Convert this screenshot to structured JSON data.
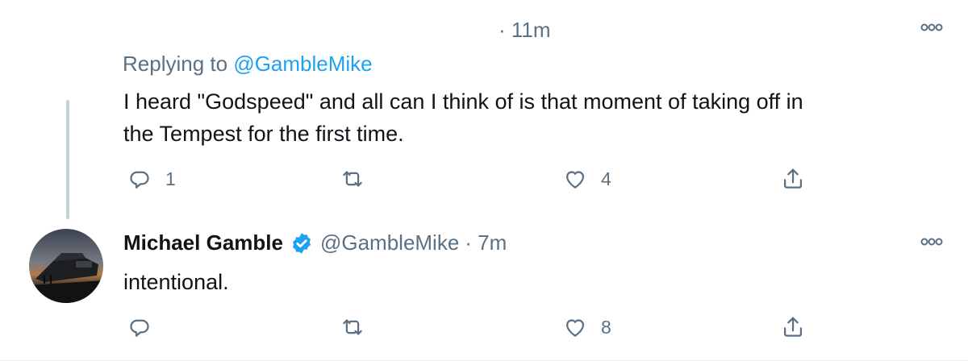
{
  "reply_tweet": {
    "timestamp": "· 11m",
    "replying_prefix": "Replying to",
    "replying_handle": "@GambleMike",
    "text_line1": "I heard \"Godspeed\" and all can I think of is that moment of taking off in",
    "text_line2": "the Tempest for the first time.",
    "reply_count": "1",
    "retweet_count": "",
    "like_count": "4"
  },
  "main_tweet": {
    "display_name": "Michael Gamble",
    "handle": "@GambleMike",
    "timestamp": "· 7m",
    "text": "intentional.",
    "reply_count": "",
    "retweet_count": "",
    "like_count": "8"
  },
  "icons": [
    "more-icon",
    "reply-icon",
    "retweet-icon",
    "like-icon",
    "share-icon",
    "verified-icon"
  ],
  "colors": {
    "accent": "#1da1f2",
    "muted": "#5b7083",
    "text": "#0f1419",
    "thread_line": "#c4cfd6"
  }
}
